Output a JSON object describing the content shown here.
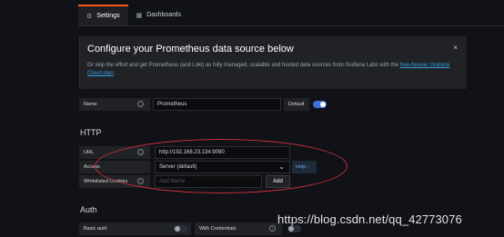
{
  "tabs": [
    {
      "label": "Settings",
      "icon": "sliders-icon",
      "active": true
    },
    {
      "label": "Dashboards",
      "icon": "grid-icon",
      "active": false
    }
  ],
  "banner": {
    "title": "Configure your Prometheus data source below",
    "text_before": "Or skip the effort and get Prometheus (and Loki) as fully managed, scalable and hosted data sources from Grafana Labs with the ",
    "link": "free-forever Grafana Cloud plan",
    "text_after": ".",
    "close": "×"
  },
  "name_field": {
    "label": "Name",
    "value": "Prometheus",
    "default_label": "Default",
    "default_on": true
  },
  "http": {
    "title": "HTTP",
    "url_label": "URL",
    "url_value": "http://192.168.23.134:9090",
    "access_label": "Access",
    "access_value": "Server (default)",
    "help": "Help ›",
    "cookies_label": "Whitelisted Cookies",
    "cookies_placeholder": "Add Name",
    "add_button": "Add"
  },
  "auth": {
    "title": "Auth",
    "basic_auth_label": "Basic auth",
    "with_credentials_label": "With Credentials"
  },
  "watermark": "https://blog.csdn.net/qq_42773076",
  "colors": {
    "accent_orange": "#f25a16",
    "toggle_blue": "#3d71d9",
    "link_blue": "#33a2e5",
    "annotation_red": "#c9303a"
  }
}
